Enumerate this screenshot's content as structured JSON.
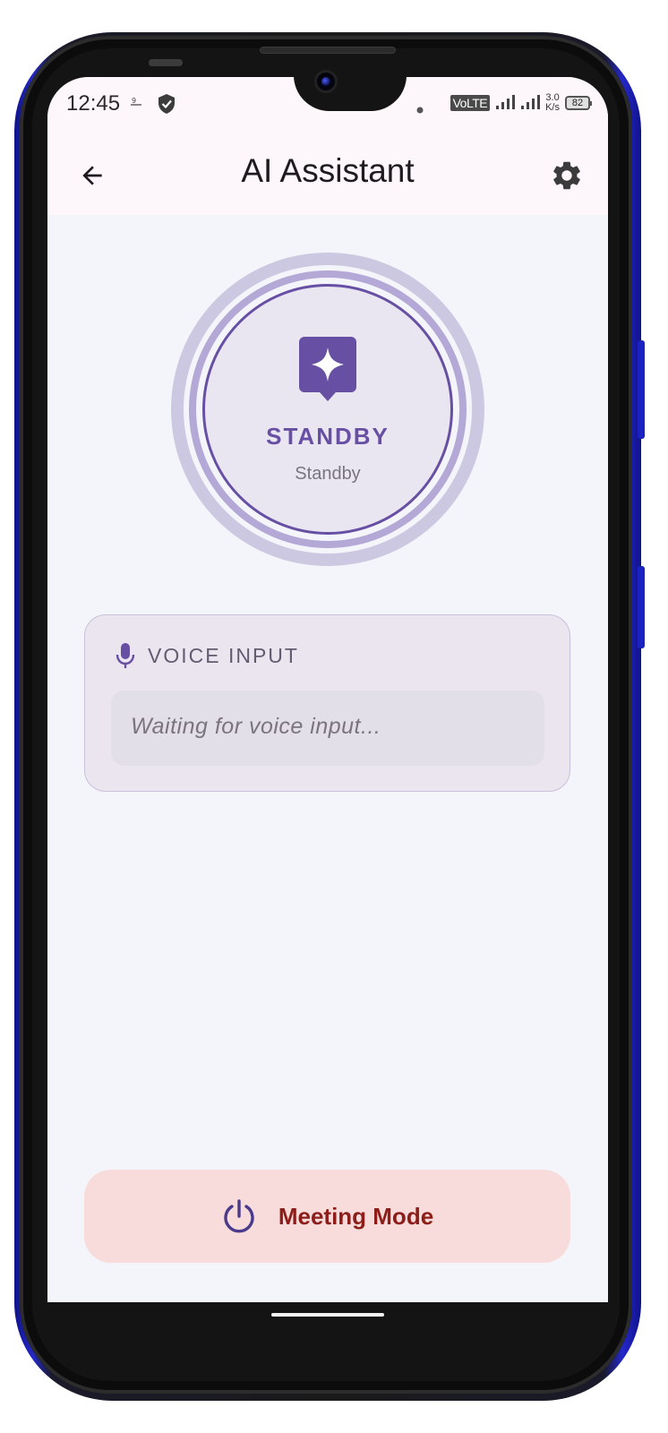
{
  "status_bar": {
    "time": "12:45",
    "network": "VoLTE",
    "speed_value": "3.0",
    "speed_unit": "K/s",
    "battery": "82"
  },
  "app_bar": {
    "title": "AI Assistant",
    "back_icon": "arrow-back-icon",
    "settings_icon": "gear-icon"
  },
  "assistant_status": {
    "label": "STANDBY",
    "sublabel": "Standby",
    "icon": "sparkle-chat-icon"
  },
  "voice_input": {
    "title": "VOICE INPUT",
    "icon": "microphone-icon",
    "placeholder": "Waiting for voice input..."
  },
  "meeting_mode": {
    "label": "Meeting Mode",
    "icon": "power-icon"
  },
  "colors": {
    "primary": "#6750a4",
    "meeting_bg": "#f8dcdb",
    "meeting_text": "#8c1d18",
    "phone_accent": "#1a22c0"
  }
}
